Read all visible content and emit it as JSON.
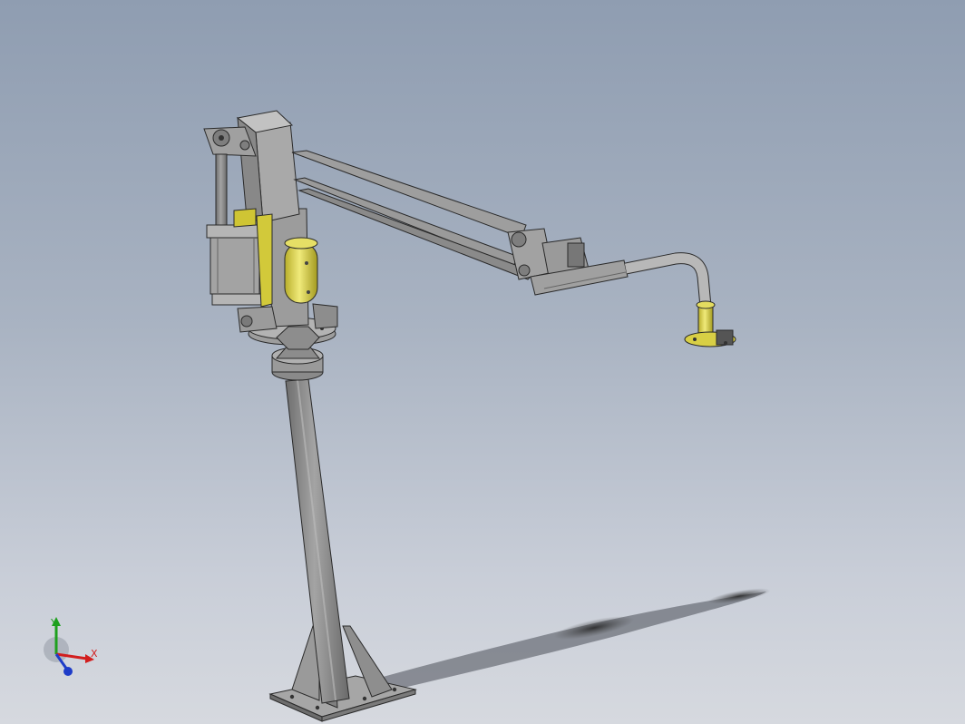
{
  "viewport": {
    "background_top": "#8f9db1",
    "background_bottom": "#d6d9df"
  },
  "model": {
    "part_color": "#8e8e8e",
    "highlight_color": "#d9d24a",
    "edge_color": "#2a2a2a"
  },
  "triad": {
    "x_label": "X",
    "y_label": "Y",
    "x_color": "#d21e1e",
    "y_color": "#1ea01e",
    "z_color": "#1e3cc8"
  }
}
